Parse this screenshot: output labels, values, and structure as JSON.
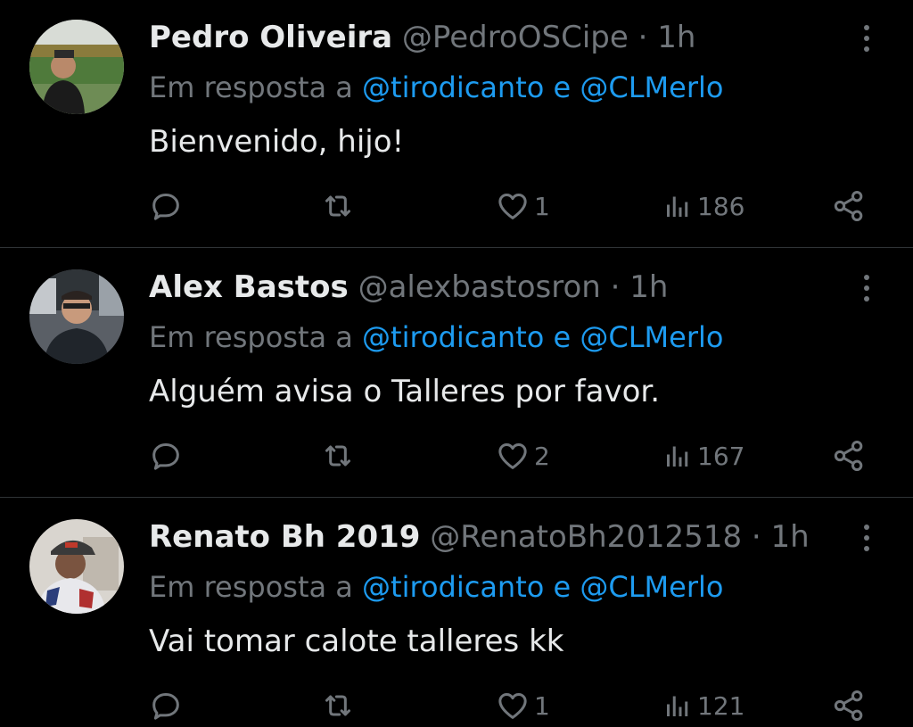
{
  "tweets": [
    {
      "name": "Pedro Oliveira",
      "handle": "@PedroOSCipe",
      "separator": "·",
      "time": "1h",
      "reply_prefix": "Em resposta a",
      "reply_to": "@tirodicanto e @CLMerlo",
      "text": "Bienvenido, hijo!",
      "replies": "",
      "retweets": "",
      "likes": "1",
      "views": "186"
    },
    {
      "name": "Alex Bastos",
      "handle": "@alexbastosron",
      "separator": "·",
      "time": "1h",
      "reply_prefix": "Em resposta a",
      "reply_to": "@tirodicanto e @CLMerlo",
      "text": "Alguém avisa o Talleres por favor.",
      "replies": "",
      "retweets": "",
      "likes": "2",
      "views": "167"
    },
    {
      "name": "Renato Bh 2019",
      "handle": "@RenatoBh2012518",
      "separator": "·",
      "time": "1h",
      "reply_prefix": "Em resposta a",
      "reply_to": "@tirodicanto e @CLMerlo",
      "text": "Vai tomar calote talleres kk",
      "replies": "",
      "retweets": "",
      "likes": "1",
      "views": "121"
    }
  ],
  "icons": {
    "reply": "reply-icon",
    "retweet": "retweet-icon",
    "like": "heart-icon",
    "views": "views-icon",
    "share": "share-icon",
    "more": "more-icon"
  },
  "colors": {
    "background": "#000000",
    "text": "#e7e9ea",
    "muted": "#71767b",
    "link": "#1d9bf0",
    "divider": "#2f3336"
  }
}
